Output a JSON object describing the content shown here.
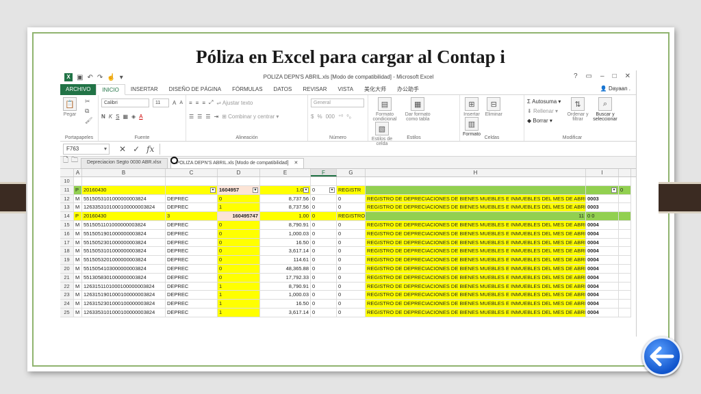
{
  "slide": {
    "title": "Póliza en Excel para cargar al Contap i"
  },
  "excel": {
    "window_title": "POLIZA DEPN'S ABRIL.xls  [Modo de compatibilidad] - Microsoft Excel",
    "help": "?",
    "user": "Dayaan .",
    "menu": [
      "ARCHIVO",
      "INICIO",
      "INSERTAR",
      "DISEÑO DE PÁGINA",
      "FÓRMULAS",
      "DATOS",
      "REVISAR",
      "VISTA",
      "美化大师",
      "办公助手"
    ],
    "ribbon": {
      "clipboard": {
        "paste": "Pegar",
        "label": "Portapapeles"
      },
      "font": {
        "name": "Calibri",
        "size": "11",
        "grow": "A",
        "shrink": "A",
        "bold": "N",
        "italic": "K",
        "underline": "S",
        "color_a": "A",
        "label": "Fuente"
      },
      "alignment": {
        "wrap": "Ajustar texto",
        "merge": "Combinar y centrar",
        "label": "Alineación"
      },
      "number": {
        "format": "General",
        "currency": "$",
        "percent": "%",
        "thousands": "000",
        "label": "Número"
      },
      "styles": {
        "cond": "Formato condicional",
        "table": "Dar formato como tabla",
        "cell": "Estilos de celda",
        "label": "Estilos"
      },
      "cells": {
        "insert": "Insertar",
        "delete": "Eliminar",
        "format": "Formato",
        "label": "Celdas"
      },
      "editing": {
        "autosum": "Autosuma",
        "fill": "Rellenar",
        "clear": "Borrar",
        "sort": "Ordenar y filtrar",
        "find": "Buscar y seleccionar",
        "label": "Modificar"
      }
    },
    "formula_bar": {
      "cell_ref": "F763",
      "value": ""
    },
    "doc_tabs": [
      {
        "label": "Depreciacion Segto 0030 ABR.xlsx"
      },
      {
        "label": "POLIZA DEPN'S ABRIL.xls  [Modo de compatibilidad]",
        "close": "✕"
      }
    ],
    "columns": [
      "A",
      "B",
      "C",
      "D",
      "E",
      "F",
      "G",
      "H",
      "I"
    ],
    "rows": [
      {
        "n": "10",
        "a": "",
        "b": "",
        "c": "",
        "d": "",
        "e": "",
        "f": "",
        "g": "",
        "h": "",
        "i": "",
        "j": ""
      },
      {
        "n": "11",
        "a": "P",
        "b": "20160430",
        "c": "",
        "d": "1604957",
        "e": "1.0",
        "f": "0",
        "g": "REGISTR",
        "h": "",
        "i": "",
        "j": "0",
        "style": "filter"
      },
      {
        "n": "12",
        "a": "M",
        "b": "5515053101000000003824",
        "c": "DEPREC",
        "d": "0",
        "e": "8,737.56",
        "f": "0",
        "g": "0",
        "h": "REGISTRO DE DEPRECIACIONES DE BIENES MUEBLES E INMUEBLES  DEL MES DE ABRIL",
        "i": "0003",
        "j": ""
      },
      {
        "n": "13",
        "a": "M",
        "b": "1263353101000100000003824",
        "c": "DEPREC",
        "d": "1",
        "e": "8,737.56",
        "f": "0",
        "g": "0",
        "h": "REGISTRO DE DEPRECIACIONES DE BIENES MUEBLES E INMUEBLES  DEL MES DE ABRIL",
        "i": "0003",
        "j": ""
      },
      {
        "n": "14",
        "a": "P",
        "b": "20160430",
        "c": "3",
        "d": "160495747",
        "e": "1.00",
        "f": "0",
        "g": "REGISTRO",
        "h": "11",
        "i": "0 0",
        "j": "",
        "style": "p"
      },
      {
        "n": "15",
        "a": "M",
        "b": "5515051101000000003824",
        "c": "DEPREC",
        "d": "0",
        "e": "8,790.91",
        "f": "0",
        "g": "0",
        "h": "REGISTRO DE DEPRECIACIONES DE BIENES MUEBLES E INMUEBLES  DEL MES DE ABRIL",
        "i": "0004",
        "j": ""
      },
      {
        "n": "16",
        "a": "M",
        "b": "5515051901000000003824",
        "c": "DEPREC",
        "d": "0",
        "e": "1,000.03",
        "f": "0",
        "g": "0",
        "h": "REGISTRO DE DEPRECIACIONES DE BIENES MUEBLES E INMUEBLES  DEL MES DE ABRIL",
        "i": "0004",
        "j": ""
      },
      {
        "n": "17",
        "a": "M",
        "b": "5515052301000000003824",
        "c": "DEPREC",
        "d": "0",
        "e": "16.50",
        "f": "0",
        "g": "0",
        "h": "REGISTRO DE DEPRECIACIONES DE BIENES MUEBLES E INMUEBLES  DEL MES DE ABRIL",
        "i": "0004",
        "j": ""
      },
      {
        "n": "18",
        "a": "M",
        "b": "5515053101000000003824",
        "c": "DEPREC",
        "d": "0",
        "e": "3,617.14",
        "f": "0",
        "g": "0",
        "h": "REGISTRO DE DEPRECIACIONES DE BIENES MUEBLES E INMUEBLES  DEL MES DE ABRIL",
        "i": "0004",
        "j": ""
      },
      {
        "n": "19",
        "a": "M",
        "b": "5515053201000000003824",
        "c": "DEPREC",
        "d": "0",
        "e": "114.61",
        "f": "0",
        "g": "0",
        "h": "REGISTRO DE DEPRECIACIONES DE BIENES MUEBLES E INMUEBLES  DEL MES DE ABRIL",
        "i": "0004",
        "j": ""
      },
      {
        "n": "20",
        "a": "M",
        "b": "5515054103000000003824",
        "c": "DEPREC",
        "d": "0",
        "e": "48,365.88",
        "f": "0",
        "g": "0",
        "h": "REGISTRO DE DEPRECIACIONES DE BIENES MUEBLES E INMUEBLES  DEL MES DE ABRIL",
        "i": "0004",
        "j": ""
      },
      {
        "n": "21",
        "a": "M",
        "b": "5513058301000000003824",
        "c": "DEPREC",
        "d": "0",
        "e": "17,792.33",
        "f": "0",
        "g": "0",
        "h": "REGISTRO DE DEPRECIACIONES DE BIENES MUEBLES E INMUEBLES  DEL MES DE ABRIL",
        "i": "0004",
        "j": ""
      },
      {
        "n": "22",
        "a": "M",
        "b": "1263151101000100000003824",
        "c": "DEPREC",
        "d": "1",
        "e": "8,790.91",
        "f": "0",
        "g": "0",
        "h": "REGISTRO DE DEPRECIACIONES DE BIENES MUEBLES E INMUEBLES  DEL MES DE ABRIL",
        "i": "0004",
        "j": ""
      },
      {
        "n": "23",
        "a": "M",
        "b": "1263151901000100000003824",
        "c": "DEPREC",
        "d": "1",
        "e": "1,000.03",
        "f": "0",
        "g": "0",
        "h": "REGISTRO DE DEPRECIACIONES DE BIENES MUEBLES E INMUEBLES  DEL MES DE ABRIL",
        "i": "0004",
        "j": ""
      },
      {
        "n": "24",
        "a": "M",
        "b": "1263152301000100000003824",
        "c": "DEPREC",
        "d": "1",
        "e": "16.50",
        "f": "0",
        "g": "0",
        "h": "REGISTRO DE DEPRECIACIONES DE BIENES MUEBLES E INMUEBLES  DEL MES DE ABRIL",
        "i": "0004",
        "j": ""
      },
      {
        "n": "25",
        "a": "M",
        "b": "1263353101000100000003824",
        "c": "DEPREC",
        "d": "1",
        "e": "3,617.14",
        "f": "0",
        "g": "0",
        "h": "REGISTRO DE DEPRECIACIONES DE BIENES MUEBLES E INMUEBLES  DEL MES DE ABRIL",
        "i": "0004",
        "j": ""
      }
    ]
  },
  "colors": {
    "excel_green": "#217346",
    "yellow": "#ffff00",
    "row_green": "#92d050",
    "slide_border": "#8fb36e",
    "back_blue": "#1155cc"
  },
  "icons": {
    "back": "back-arrow-icon"
  }
}
